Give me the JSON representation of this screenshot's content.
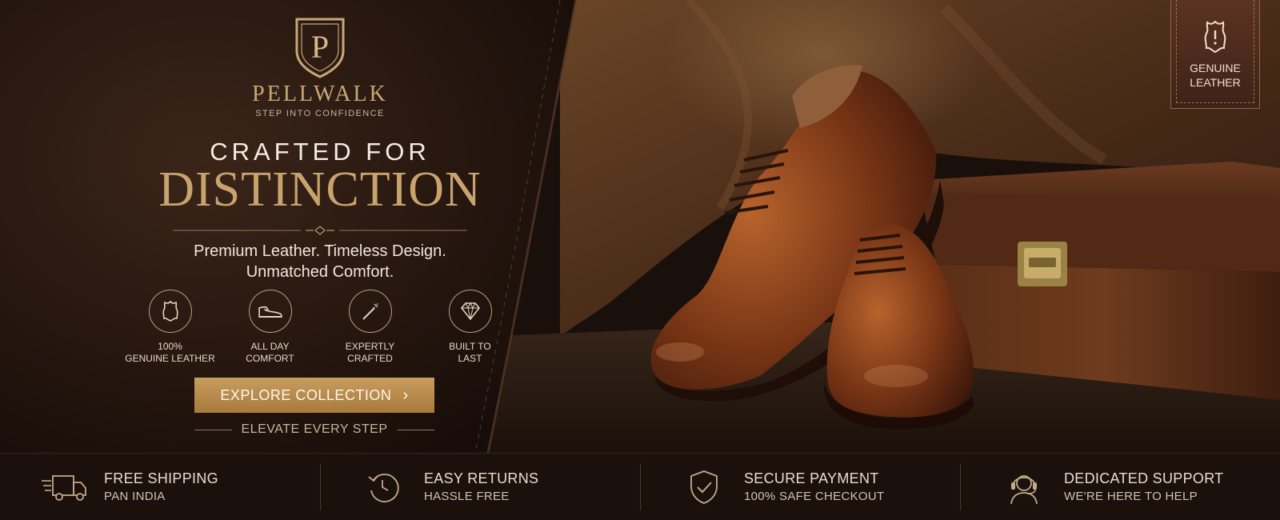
{
  "brand": {
    "logo_letter": "P",
    "name": "PELLWALK",
    "tagline": "STEP INTO CONFIDENCE"
  },
  "hero": {
    "headline_line1": "CRAFTED FOR",
    "headline_line2": "DISTINCTION",
    "subcopy_line1": "Premium Leather. Timeless Design.",
    "subcopy_line2": "Unmatched Comfort.",
    "features": [
      {
        "icon": "leather-hide-icon",
        "line1": "100%",
        "line2": "GENUINE LEATHER"
      },
      {
        "icon": "shoe-icon",
        "line1": "ALL DAY",
        "line2": "COMFORT"
      },
      {
        "icon": "awl-tool-icon",
        "line1": "EXPERTLY",
        "line2": "CRAFTED"
      },
      {
        "icon": "diamond-icon",
        "line1": "BUILT TO",
        "line2": "LAST"
      }
    ],
    "cta_label": "EXPLORE COLLECTION",
    "cta_icon": "chevron-right-icon",
    "elevate_text": "ELEVATE EVERY STEP"
  },
  "badge": {
    "icon": "leather-hide-icon",
    "line1": "GENUINE",
    "line2": "LEATHER"
  },
  "benefits": [
    {
      "icon": "truck-icon",
      "title": "FREE SHIPPING",
      "subtitle": "PAN INDIA"
    },
    {
      "icon": "returns-icon",
      "title": "EASY RETURNS",
      "subtitle": "HASSLE FREE"
    },
    {
      "icon": "shield-check-icon",
      "title": "SECURE PAYMENT",
      "subtitle": "100% SAFE CHECKOUT"
    },
    {
      "icon": "headset-icon",
      "title": "DEDICATED SUPPORT",
      "subtitle": "WE'RE HERE TO HELP"
    }
  ],
  "colors": {
    "gold": "#c9a36d",
    "dark_bg": "#1a100c",
    "cta_gold": "#b98b4d",
    "leather_brown": "#7a3f1e"
  }
}
